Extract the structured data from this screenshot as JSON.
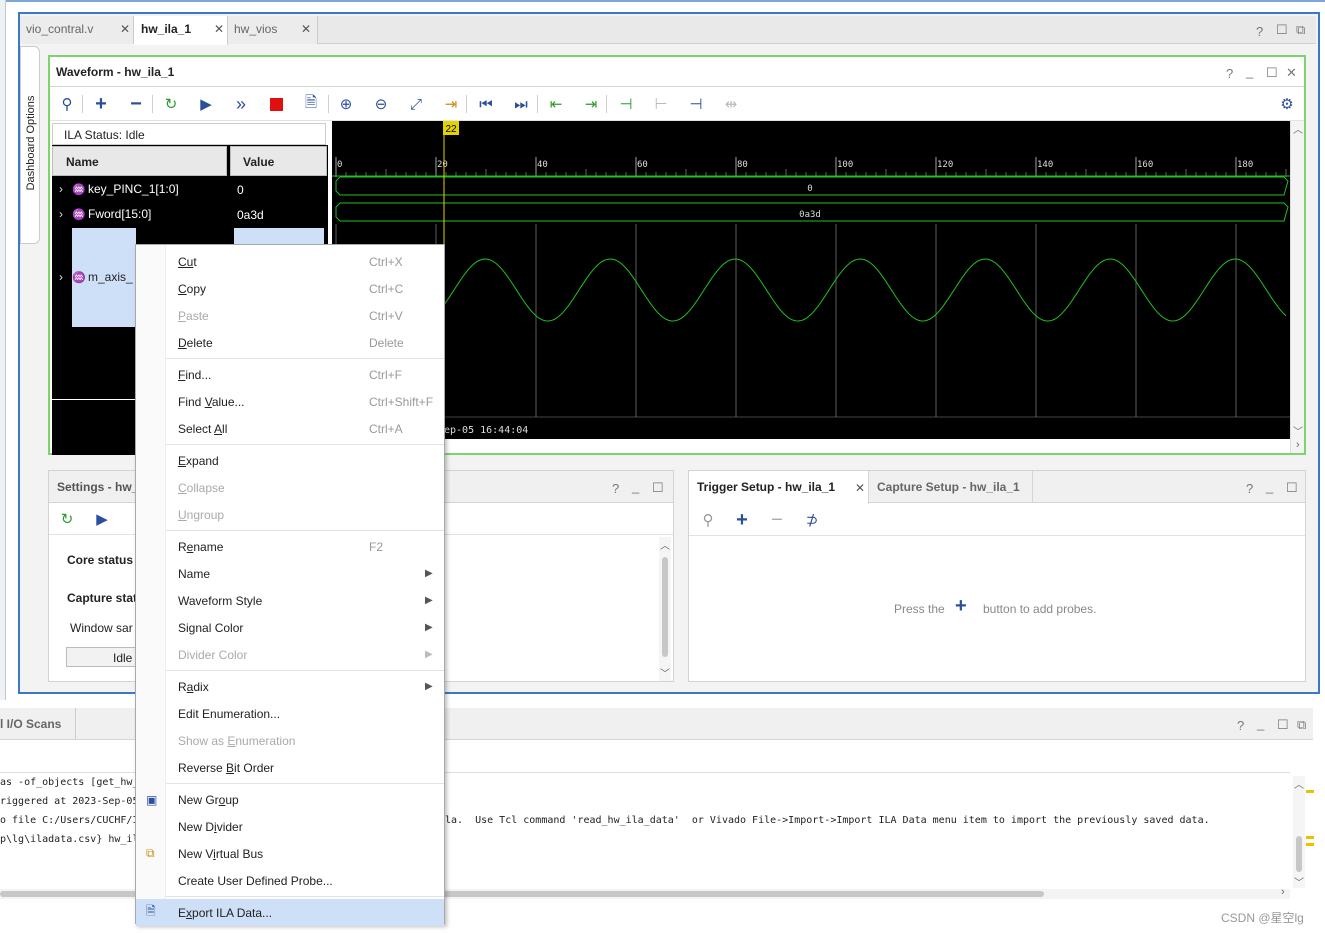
{
  "editor_tabs": [
    {
      "label": "vio_contral.v"
    },
    {
      "label": "hw_ila_1"
    },
    {
      "label": "hw_vios"
    }
  ],
  "dashboard_options": "Dashboard Options",
  "waveform": {
    "title": "Waveform - hw_ila_1",
    "ila_status": "ILA Status:  Idle",
    "col_name": "Name",
    "col_value": "Value",
    "signals": [
      {
        "name": "key_PINC_1[1:0]",
        "value": "0"
      },
      {
        "name": "Fword[15:0]",
        "value": "0a3d"
      },
      {
        "name": "m_axis_",
        "value": ""
      }
    ],
    "cursor_label": "22",
    "ruler": [
      "0",
      "20",
      "40",
      "60",
      "80",
      "100",
      "120",
      "140",
      "160",
      "180"
    ],
    "bus_values": [
      "0",
      "0a3d"
    ],
    "timestamp": "ep-05 16:44:04"
  },
  "settings": {
    "title": "Settings - hw_",
    "core_status": "Core status",
    "capture_status": "Capture stat",
    "window_label": "Window sar",
    "idle": "Idle"
  },
  "trigger": {
    "tab1": "Trigger Setup - hw_ila_1",
    "tab2": "Capture Setup - hw_ila_1",
    "hint_pre": "Press the",
    "hint_post": "button to add probes."
  },
  "console": {
    "tab": "l I/O Scans",
    "lines": [
      "as -of_objects [get_hw_",
      "riggered at 2023-Sep-05",
      "o file C:/Users/CUCHF/I",
      "p\\lg\\iladata.csv} hw_il"
    ],
    "line3_tail": "la.  Use Tcl command 'read_hw_ila_data'  or Vivado File->Import->Import ILA Data menu item to import the previously saved data."
  },
  "context_menu": [
    {
      "label": "Cut",
      "shortcut": "Ctrl+X",
      "enabled": true
    },
    {
      "label": "Copy",
      "shortcut": "Ctrl+C",
      "enabled": true
    },
    {
      "label": "Paste",
      "shortcut": "Ctrl+V",
      "enabled": false
    },
    {
      "label": "Delete",
      "shortcut": "Delete",
      "enabled": true
    },
    {
      "label": "Find...",
      "shortcut": "Ctrl+F",
      "enabled": true
    },
    {
      "label": "Find Value...",
      "shortcut": "Ctrl+Shift+F",
      "enabled": true
    },
    {
      "label": "Select All",
      "shortcut": "Ctrl+A",
      "enabled": true
    },
    {
      "label": "Expand",
      "shortcut": "",
      "enabled": true
    },
    {
      "label": "Collapse",
      "shortcut": "",
      "enabled": false
    },
    {
      "label": "Ungroup",
      "shortcut": "",
      "enabled": false
    },
    {
      "label": "Rename",
      "shortcut": "F2",
      "enabled": true
    },
    {
      "label": "Name",
      "shortcut": "",
      "enabled": true
    },
    {
      "label": "Waveform Style",
      "shortcut": "",
      "enabled": true
    },
    {
      "label": "Signal Color",
      "shortcut": "",
      "enabled": true
    },
    {
      "label": "Divider Color",
      "shortcut": "",
      "enabled": false
    },
    {
      "label": "Radix",
      "shortcut": "",
      "enabled": true
    },
    {
      "label": "Edit Enumeration...",
      "shortcut": "",
      "enabled": true
    },
    {
      "label": "Show as Enumeration",
      "shortcut": "",
      "enabled": false
    },
    {
      "label": "Reverse Bit Order",
      "shortcut": "",
      "enabled": true
    },
    {
      "label": "New Group",
      "shortcut": "",
      "enabled": true
    },
    {
      "label": "New Divider",
      "shortcut": "",
      "enabled": true
    },
    {
      "label": "New Virtual Bus",
      "shortcut": "",
      "enabled": true
    },
    {
      "label": "Create User Defined Probe...",
      "shortcut": "",
      "enabled": true
    },
    {
      "label": "Export ILA Data...",
      "shortcut": "",
      "enabled": true
    }
  ],
  "watermark": "CSDN @星空lg",
  "colors": {
    "accent": "#3a78c9",
    "waveform_green": "#22c022",
    "highlight": "#cde0f7",
    "frame_green": "#7fd36f"
  }
}
